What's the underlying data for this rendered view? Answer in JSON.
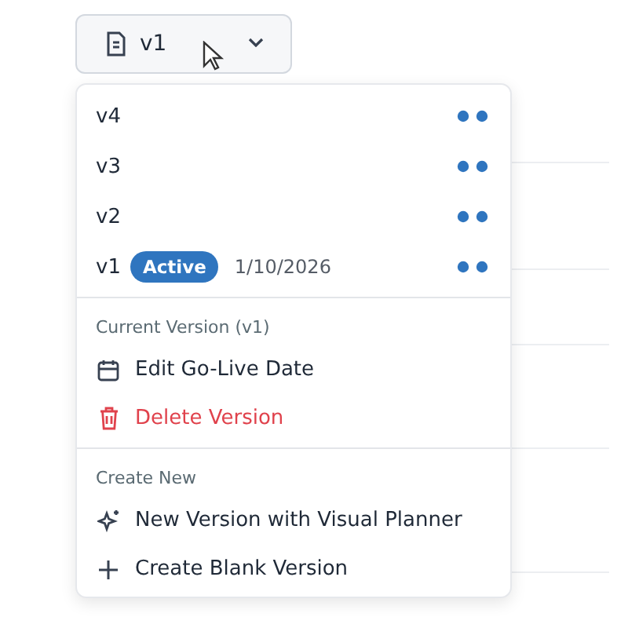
{
  "version_button": {
    "label": "v1",
    "expanded": true
  },
  "versions": [
    {
      "label": "v4"
    },
    {
      "label": "v3"
    },
    {
      "label": "v2"
    },
    {
      "label": "v1",
      "badge": "Active",
      "date": "1/10/2026"
    }
  ],
  "sections": [
    {
      "heading": "Current Version (v1)",
      "items": [
        {
          "label": "Edit Go-Live Date",
          "kind": "calendar"
        },
        {
          "label": "Delete Version",
          "kind": "delete"
        }
      ]
    },
    {
      "heading": "Create New",
      "items": [
        {
          "label": "New Version with Visual Planner",
          "kind": "sparkle"
        },
        {
          "label": "Create Blank Version",
          "kind": "plus"
        }
      ]
    }
  ]
}
